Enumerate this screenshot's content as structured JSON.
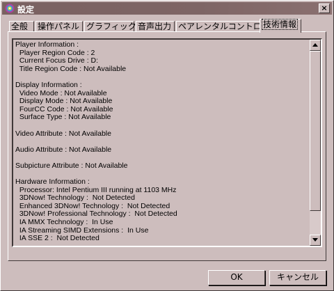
{
  "window": {
    "title": "設定"
  },
  "tabs": [
    "全般",
    "操作パネル",
    "グラフィック",
    "音声出力",
    "ペアレンタルコントロール",
    "技術情報"
  ],
  "active_tab": "技術情報",
  "info_lines": [
    "Player Information :",
    "  Player Region Code : 2",
    "  Current Focus Drive : D:",
    "  Title Region Code : Not Available",
    "",
    "Display Information :",
    "  Video Mode : Not Available",
    "  Display Mode : Not Available",
    "  FourCC Code : Not Available",
    "  Surface Type : Not Available",
    "",
    "Video Attribute : Not Available",
    "",
    "Audio Attribute : Not Available",
    "",
    "Subpicture Attribute : Not Available",
    "",
    "Hardware Information :",
    "  Processor: Intel Pentium III running at 1103 MHz",
    "  3DNow! Technology :  Not Detected",
    "  Enhanced 3DNow! Technology :  Not Detected",
    "  3DNow! Professional Technology :  Not Detected",
    "  IA MMX Technology :  In Use",
    "  IA Streaming SIMD Extensions :  In Use",
    "  IA SSE 2 :  Not Detected"
  ],
  "buttons": {
    "ok": "OK",
    "cancel": "キャンセル"
  },
  "close_glyph": "×"
}
